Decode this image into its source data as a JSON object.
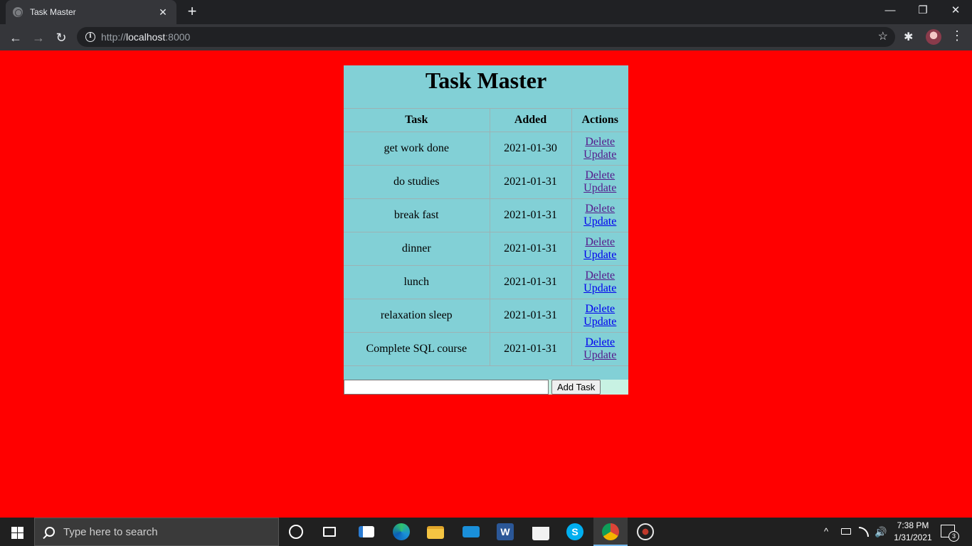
{
  "browser": {
    "tab_title": "Task Master",
    "tab_close": "✕",
    "new_tab": "+",
    "url_scheme": "http://",
    "url_host": "localhost",
    "url_port": ":8000",
    "window_minimize": "—",
    "window_restore": "❐",
    "window_close": "✕",
    "back": "←",
    "forward": "→",
    "reload": "↻",
    "star": "☆",
    "extensions": "✱",
    "menu": "⋮",
    "info": "i"
  },
  "page": {
    "title": "Task Master",
    "background_color": "#ff0000",
    "card_color": "#82d0d6",
    "table": {
      "headers": [
        "Task",
        "Added",
        "Actions"
      ],
      "rows": [
        {
          "task": "get work done",
          "added": "2021-01-30",
          "delete": "Delete",
          "update": "Update"
        },
        {
          "task": "do studies",
          "added": "2021-01-31",
          "delete": "Delete",
          "update": "Update"
        },
        {
          "task": "break fast",
          "added": "2021-01-31",
          "delete": "Delete",
          "update": "Update"
        },
        {
          "task": "dinner",
          "added": "2021-01-31",
          "delete": "Delete",
          "update": "Update"
        },
        {
          "task": "lunch",
          "added": "2021-01-31",
          "delete": "Delete",
          "update": "Update"
        },
        {
          "task": "relaxation sleep",
          "added": "2021-01-31",
          "delete": "Delete",
          "update": "Update"
        },
        {
          "task": "Complete SQL course",
          "added": "2021-01-31",
          "delete": "Delete",
          "update": "Update"
        }
      ]
    },
    "add_form": {
      "input_value": "",
      "button_label": "Add Task"
    }
  },
  "taskbar": {
    "search_placeholder": "Type here to search",
    "time": "7:38 PM",
    "date": "1/31/2021",
    "notification_count": "3",
    "tray_chevron": "^",
    "icons": [
      "cortana-icon",
      "task-view-icon",
      "news-icon",
      "edge-icon",
      "file-explorer-icon",
      "mail-icon",
      "word-icon",
      "store-icon",
      "skype-icon",
      "chrome-icon",
      "spider-app-icon"
    ]
  }
}
